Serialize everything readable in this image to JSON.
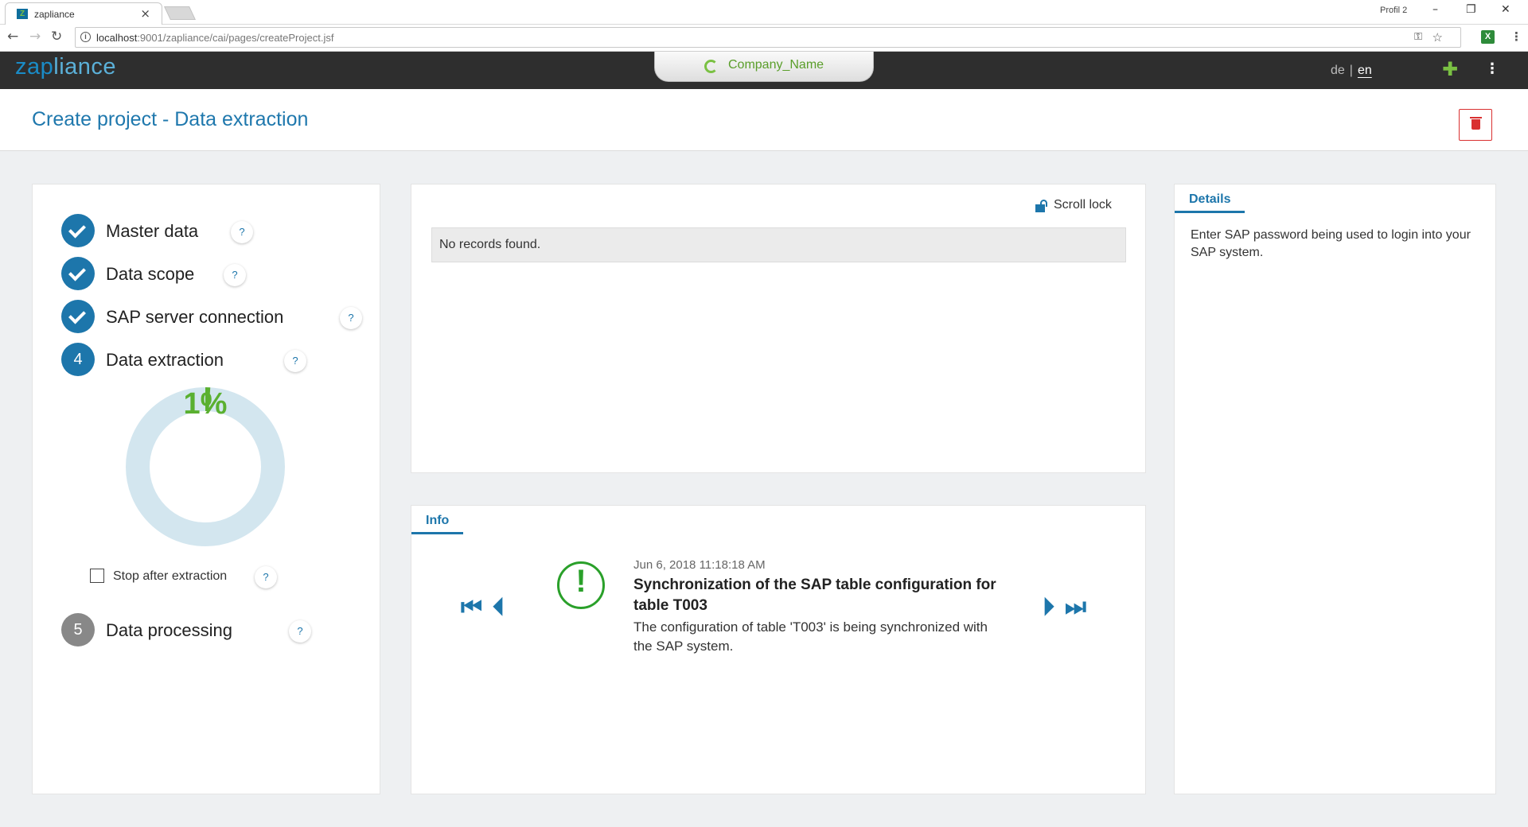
{
  "browser": {
    "tab_title": "zapliance",
    "profile": "Profil 2",
    "url_host": "localhost",
    "url_rest": ":9001/zapliance/cai/pages/createProject.jsf"
  },
  "app": {
    "logo_a": "zap",
    "logo_b": "liance",
    "company": "Company_Name",
    "lang_de": "de",
    "lang_separator": "|",
    "lang_en": "en",
    "add_icon": "plus-icon",
    "menu_icon": "kebab-menu-icon"
  },
  "page": {
    "title": "Create project - Data extraction",
    "delete_icon": "trash-icon"
  },
  "steps": [
    {
      "label": "Master data",
      "state": "done",
      "help": "?"
    },
    {
      "label": "Data scope",
      "state": "done",
      "help": "?"
    },
    {
      "label": "SAP server connection",
      "state": "done",
      "help": "?"
    },
    {
      "label": "Data extraction",
      "number": "4",
      "state": "active",
      "help": "?"
    },
    {
      "label": "Data processing",
      "number": "5",
      "state": "pending",
      "help": "?"
    }
  ],
  "progress": {
    "percent_label": "1%",
    "value": 1,
    "track_color": "#d3e6ef",
    "fill_color": "#5ab030"
  },
  "stop_after_extraction": {
    "label": "Stop after extraction",
    "checked": false,
    "help": "?"
  },
  "log": {
    "scroll_lock_label": "Scroll lock",
    "empty_message": "No records found."
  },
  "info": {
    "tab_label": "Info",
    "timestamp": "Jun 6, 2018 11:18:18 AM",
    "title": "Synchronization of the SAP table configuration for table T003",
    "description": "The configuration of table 'T003' is being synchronized with the SAP system.",
    "icon": "exclamation-circle-icon"
  },
  "details": {
    "tab_label": "Details",
    "text": "Enter SAP password being used to login into your SAP system."
  },
  "colors": {
    "accent": "#1d76ab",
    "brand_green": "#7ac143",
    "danger": "#d93030"
  }
}
